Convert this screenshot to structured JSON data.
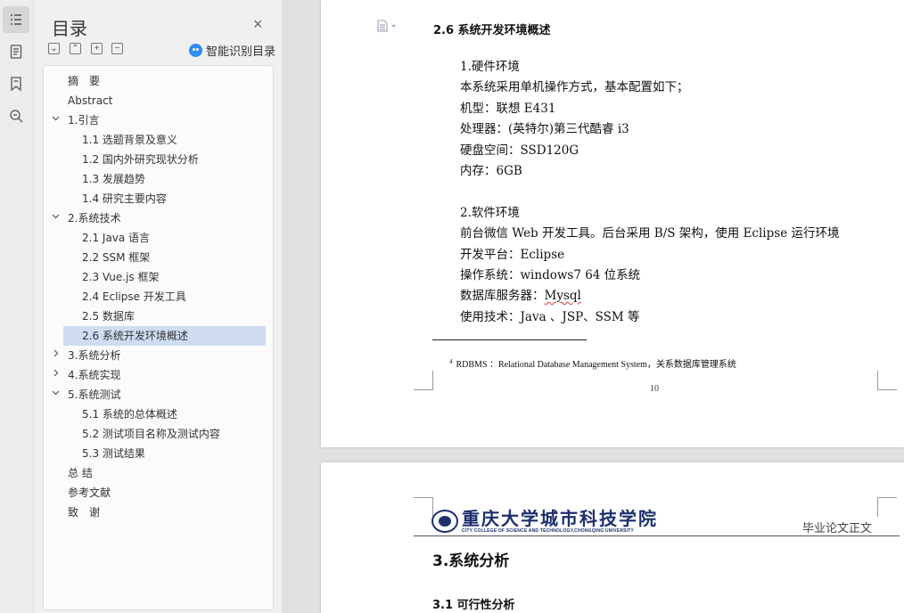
{
  "rail": {
    "icons": [
      "toc-icon",
      "document-icon",
      "bookmark-icon",
      "find-icon"
    ]
  },
  "toc": {
    "title": "目录",
    "close_glyph": "×",
    "tools": [
      "⌄",
      "⌃",
      "+",
      "−"
    ],
    "smart_label": "智能识别目录",
    "items": [
      {
        "label": "摘　要",
        "level": 0,
        "state": "none"
      },
      {
        "label": "Abstract",
        "level": 0,
        "state": "none"
      },
      {
        "label": "1.引言",
        "level": 0,
        "state": "expanded"
      },
      {
        "label": "1.1 选题背景及意义",
        "level": 1,
        "state": "none"
      },
      {
        "label": "1.2  国内外研究现状分析",
        "level": 1,
        "state": "none"
      },
      {
        "label": "1.3  发展趋势",
        "level": 1,
        "state": "none"
      },
      {
        "label": "1.4  研究主要内容",
        "level": 1,
        "state": "none"
      },
      {
        "label": "2.系统技术",
        "level": 0,
        "state": "expanded"
      },
      {
        "label": "2.1 Java 语言",
        "level": 1,
        "state": "none"
      },
      {
        "label": "2.2 SSM 框架",
        "level": 1,
        "state": "none"
      },
      {
        "label": "2.3 Vue.js 框架",
        "level": 1,
        "state": "none"
      },
      {
        "label": "2.4 Eclipse 开发工具",
        "level": 1,
        "state": "none"
      },
      {
        "label": "2.5 数据库",
        "level": 1,
        "state": "none"
      },
      {
        "label": "2.6 系统开发环境概述",
        "level": 1,
        "state": "selected"
      },
      {
        "label": "3.系统分析",
        "level": 0,
        "state": "collapsed"
      },
      {
        "label": "4.系统实现",
        "level": 0,
        "state": "collapsed"
      },
      {
        "label": "5.系统测试",
        "level": 0,
        "state": "expanded"
      },
      {
        "label": "5.1 系统的总体概述",
        "level": 1,
        "state": "none"
      },
      {
        "label": "5.2 测试项目名称及测试内容",
        "level": 1,
        "state": "none"
      },
      {
        "label": "5.3 测试结果",
        "level": 1,
        "state": "none"
      },
      {
        "label": "总 结",
        "level": 0,
        "state": "none"
      },
      {
        "label": "参考文献",
        "level": 0,
        "state": "none"
      },
      {
        "label": "致　谢",
        "level": 0,
        "state": "none"
      }
    ]
  },
  "page1": {
    "section_heading": "2.6 系统开发环境概述",
    "lines": [
      "1.硬件环境",
      "本系统采用单机操作方式，基本配置如下；",
      "机型：联想 E431",
      "处理器：(英特尔)第三代酷睿  i3",
      "硬盘空间：SSD120G",
      "内存：6GB",
      "",
      "2.软件环境",
      "前台微信 Web 开发工具。后台采用 B/S 架构，使用 Eclipse 运行环境",
      "开发平台：Eclipse",
      "操作系统：windows7 64 位系统",
      "数据库服务器：",
      "使用技术：Java  、JSP、SSM 等"
    ],
    "db_name": "Mysql",
    "footnote_mark": "4",
    "footnote": "RDBMS ：Relational Database Management System，关系数据库管理系统",
    "page_number": "10"
  },
  "page2": {
    "logo_cn": "重庆大学城市科技学院",
    "logo_en": "CITY COLLEGE OF SCIENCE AND TECHNOLOGY,CHONGQING UNIVERSITY",
    "header_right": "毕业论文正文",
    "chapter_title": "3.系统分析",
    "sub_title": "3.1 可行性分析"
  }
}
